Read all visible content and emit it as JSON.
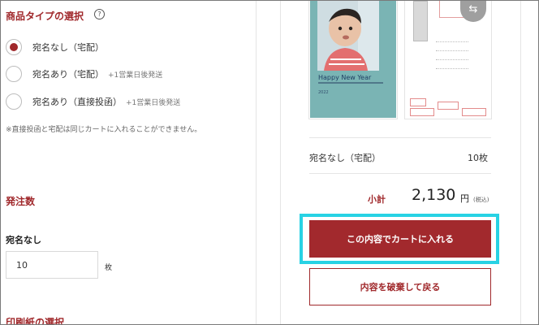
{
  "product_type": {
    "title": "商品タイプの選択",
    "help_icon": "?",
    "options": [
      {
        "label": "宛名なし（宅配）",
        "note": "",
        "checked": true
      },
      {
        "label": "宛名あり（宅配）",
        "note": "+1営業日後発送",
        "checked": false
      },
      {
        "label": "宛名あり（直接投函）",
        "note": "+1営業日後発送",
        "checked": false
      }
    ],
    "note": "※直接投函と宅配は同じカートに入れることができません。"
  },
  "order_qty": {
    "title": "発注数",
    "label": "宛名なし",
    "value": "10",
    "unit": "枚"
  },
  "paper": {
    "title": "印刷紙の選択"
  },
  "preview": {
    "greeting": "Happy New Year",
    "year": "2022",
    "icon": "photo-switch-icon"
  },
  "summary": {
    "type": "宛名なし（宅配）",
    "count": "10枚",
    "subtotal_label": "小計",
    "subtotal_price": "2,130",
    "subtotal_unit": "円",
    "subtotal_tax": "(税込)"
  },
  "buttons": {
    "add_to_cart": "この内容でカートに入れる",
    "discard": "内容を破棄して戻る"
  },
  "colors": {
    "accent": "#a2292d",
    "highlight": "#28d2e4",
    "card_teal": "#7ab4b4"
  }
}
